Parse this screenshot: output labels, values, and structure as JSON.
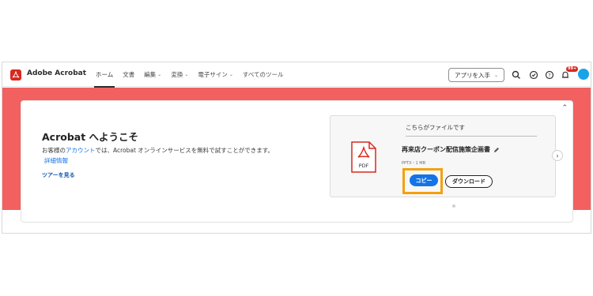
{
  "app": {
    "name": "Adobe Acrobat"
  },
  "nav": {
    "home": "ホーム",
    "documents": "文書",
    "edit": "編集",
    "convert": "変換",
    "esign": "電子サイン",
    "all_tools": "すべてのツール"
  },
  "toolbar": {
    "get_apps_label": "アプリを入手",
    "notifications_badge": "99+"
  },
  "welcome": {
    "title": "Acrobat へようこそ",
    "text_before": "お客様の",
    "account_link": "アカウント",
    "text_after": "では、Acrobat オンラインサービスを無料で試すことができます。",
    "details_link": "詳細情報",
    "tour_link": "ツアーを見る"
  },
  "file_panel": {
    "title": "こちらがファイルです",
    "file_name": "再来店クーポン配信施策企画書",
    "file_meta": "PPTX・1 MB",
    "pdf_label": "PDF",
    "copy_label": "コピー",
    "download_label": "ダウンロード"
  },
  "colors": {
    "hero": "#f26060",
    "accent": "#1473e6",
    "highlight": "#f5a00f",
    "brand": "#d7291f"
  },
  "icons": [
    "acrobat-logo-icon",
    "search-icon",
    "check-circle-icon",
    "help-icon",
    "bell-icon",
    "collapse-chevron-icon",
    "pdf-file-icon",
    "pencil-icon",
    "chevron-right-icon"
  ]
}
